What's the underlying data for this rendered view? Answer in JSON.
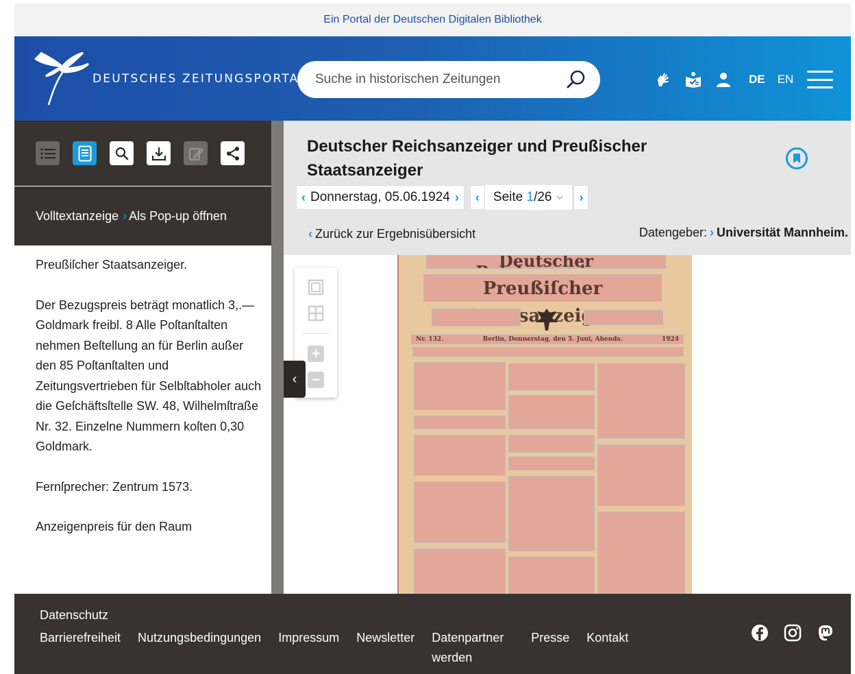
{
  "portal_bar": {
    "text": "Ein Portal der Deutschen Digitalen Bibliothek"
  },
  "header": {
    "brand": "DEUTSCHES ZEITUNGSPORTAL",
    "search_placeholder": "Suche in historischen Zeitungen",
    "icons": [
      "sign-language-icon",
      "easy-language-icon",
      "user-icon"
    ],
    "lang_de": "DE",
    "lang_en": "EN",
    "active_lang": "DE"
  },
  "sidebar": {
    "tools": [
      "list-icon",
      "document-icon",
      "search-icon",
      "download-icon",
      "edit-icon",
      "share-icon"
    ],
    "fulltext_label": "Volltextanzeige",
    "popup_label": "Als Pop-up öffnen",
    "paragraphs": [
      "Preußiſcher Staatsanzeiger.",
      "Der Bezugspreis beträgt monatlich 3,.— Goldmark freibl. 8 Alle Poſtanſtalten nehmen Beſtellung an für Berlin außer den 85 Poſtanſtalten und Zeitungsvertrieben für Selbſtabholer auch die Geſchäftsſtelle SW. 48, Wilhelmſtraße Nr. 32. Einzelne Nummern koſten 0,30 Goldmark.",
      "Fernſprecher: Zentrum 1573.",
      "Anzeigenpreis für den Raum"
    ]
  },
  "document": {
    "title": "Deutscher Reichsanzeiger und Preußischer Staatsanzeiger",
    "date": "Donnerstag, 05.06.1924",
    "page_label": "Seite",
    "page_current": "1",
    "page_total": "/26",
    "back_label": "Zurück zur Ergebnisübersicht",
    "provider_label": "Datengeber:",
    "provider_name": "Universität Mannheim."
  },
  "viewer": {
    "np_title1": "Deutscher Reichsanzeiger",
    "np_title2": "Preußiſcher Staatsanzeiger.",
    "np_number": "Nr. 132.",
    "np_dateline": "Berlin, Donnerstag, den 5. Juni, Abends.",
    "np_year": "1924"
  },
  "footer": {
    "datenschutz": "Datenschutz",
    "links": [
      "Barrierefreiheit",
      "Nutzungsbedingungen",
      "Impressum",
      "Newsletter",
      "Datenpartner werden",
      "Presse",
      "Kontakt"
    ],
    "social": [
      "facebook-icon",
      "instagram-icon",
      "mastodon-icon"
    ]
  },
  "colors": {
    "header_start": "#1d4ea7",
    "header_end": "#0f93d8",
    "accent": "#1e9ad9",
    "dark": "#383330"
  }
}
